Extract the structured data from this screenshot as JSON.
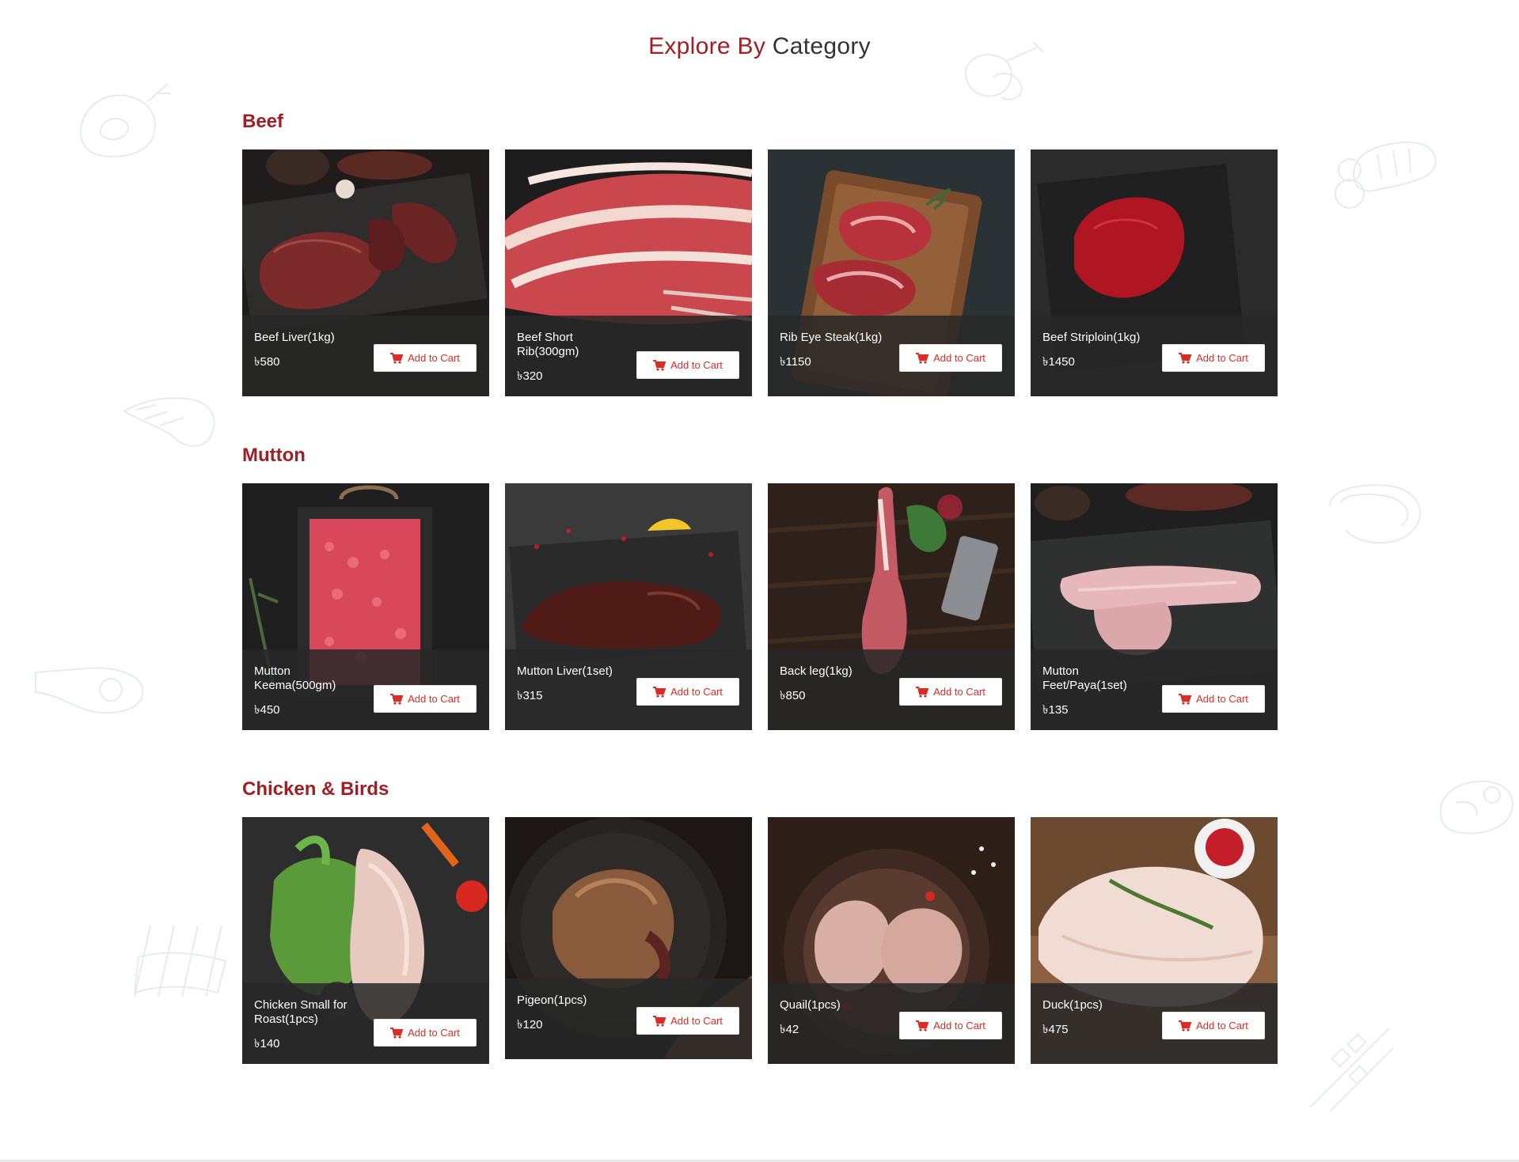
{
  "header": {
    "title_accent": "Explore By",
    "title_rest": "Category"
  },
  "colors": {
    "accent": "#a01e24",
    "button_text": "#d92d27"
  },
  "icons": {
    "cart": "shopping-cart-icon",
    "currency": "taka-sign"
  },
  "sections": [
    {
      "title": "Beef",
      "products": [
        {
          "name": "Beef Liver(1kg)",
          "price": "৳580",
          "button": "Add to Cart"
        },
        {
          "name": "Beef Short Rib(300gm)",
          "price": "৳320",
          "button": "Add to Cart"
        },
        {
          "name": "Rib Eye Steak(1kg)",
          "price": "৳1150",
          "button": "Add to Cart"
        },
        {
          "name": "Beef Striploin(1kg)",
          "price": "৳1450",
          "button": "Add to Cart"
        }
      ]
    },
    {
      "title": "Mutton",
      "products": [
        {
          "name": "Mutton Keema(500gm)",
          "price": "৳450",
          "button": "Add to Cart"
        },
        {
          "name": "Mutton Liver(1set)",
          "price": "৳315",
          "button": "Add to Cart"
        },
        {
          "name": "Back leg(1kg)",
          "price": "৳850",
          "button": "Add to Cart"
        },
        {
          "name": "Mutton Feet/Paya(1set)",
          "price": "৳135",
          "button": "Add to Cart"
        }
      ]
    },
    {
      "title": "Chicken & Birds",
      "products": [
        {
          "name": "Chicken Small for Roast(1pcs)",
          "price": "৳140",
          "button": "Add to Cart"
        },
        {
          "name": "Pigeon(1pcs)",
          "price": "৳120",
          "button": "Add to Cart"
        },
        {
          "name": "Quail(1pcs)",
          "price": "৳42",
          "button": "Add to Cart"
        },
        {
          "name": "Duck(1pcs)",
          "price": "৳475",
          "button": "Add to Cart"
        }
      ]
    }
  ]
}
